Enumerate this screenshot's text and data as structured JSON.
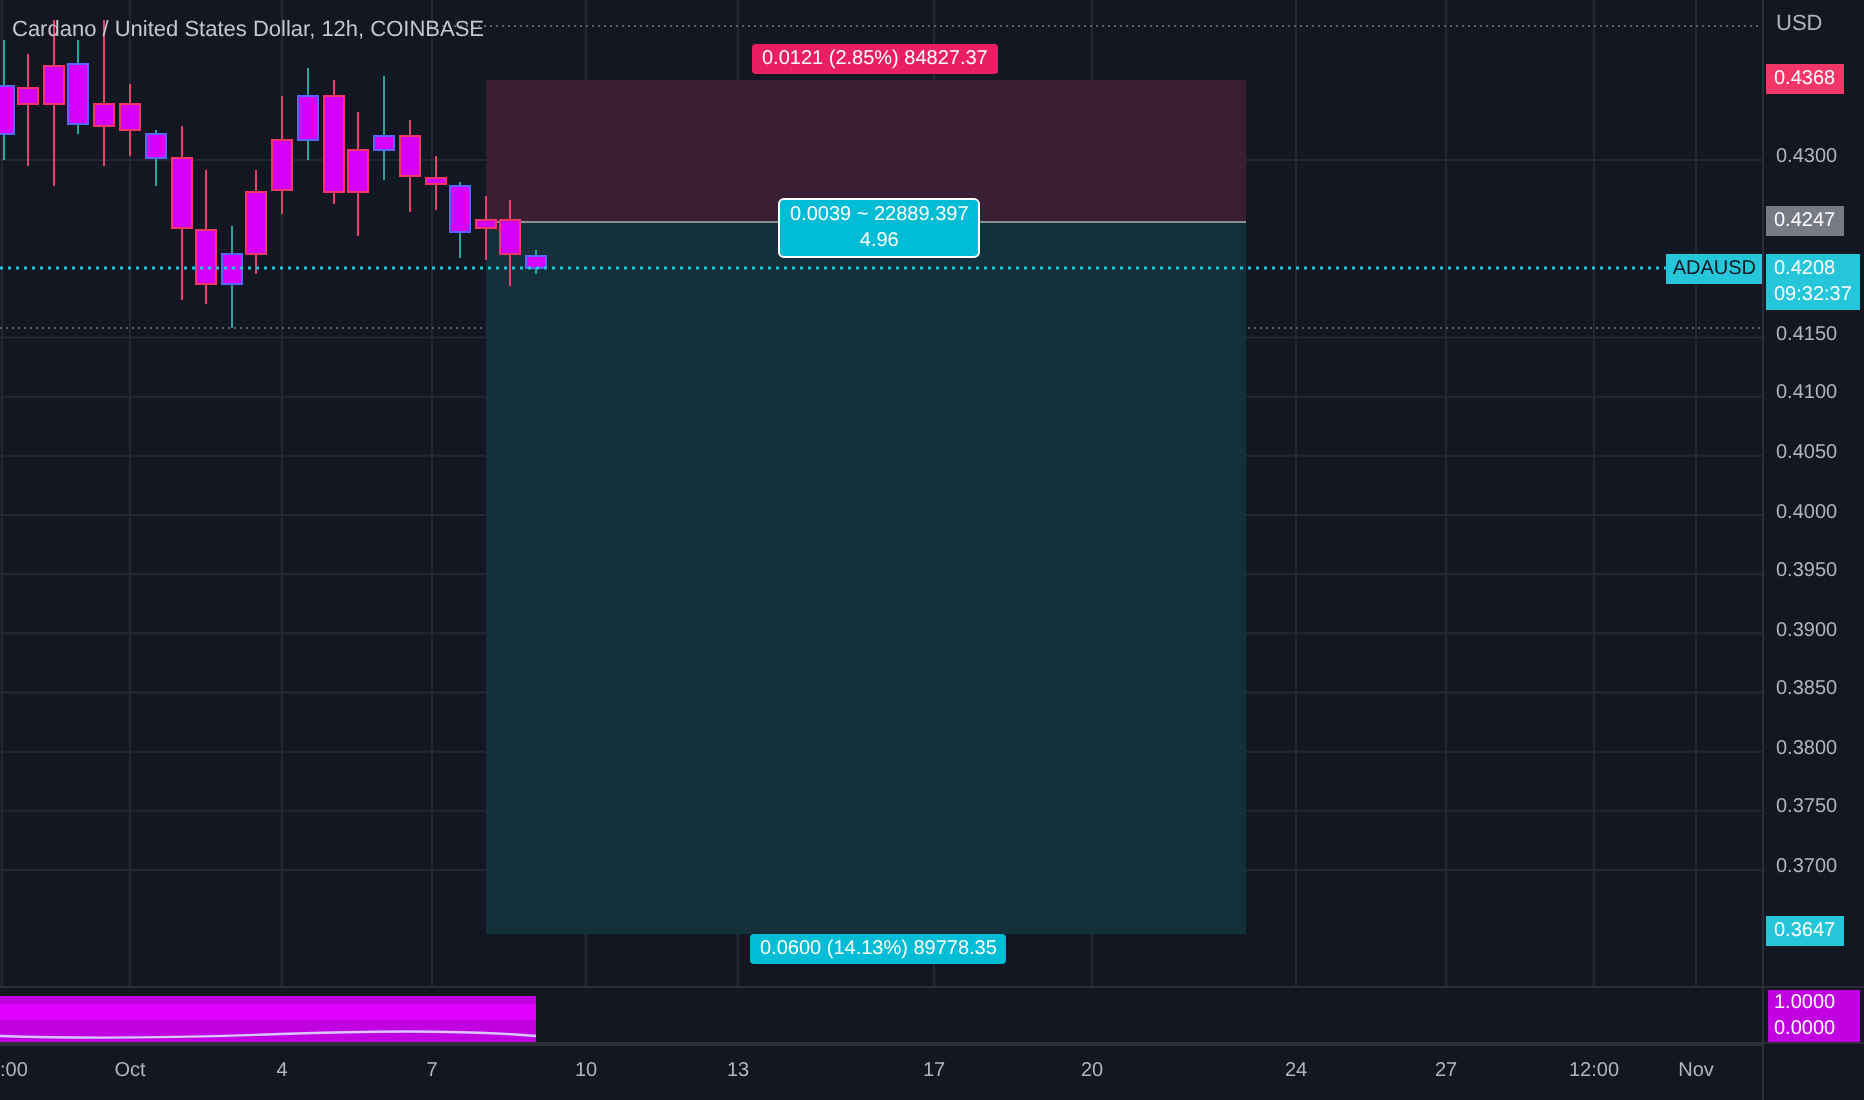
{
  "chart": {
    "title": "Cardano / United States Dollar, 12h, COINBASE",
    "position": {
      "upper_label": "0.0121 (2.85%) 84827.37",
      "middle_label": [
        "0.0039 ~ 22889.397",
        "4.96"
      ],
      "lower_label": "0.0600 (14.13%) 89778.35"
    },
    "symbol_tag": "ADAUSD"
  },
  "price_axis": {
    "unit": "USD",
    "ticks": [
      "0.4300",
      "0.4150",
      "0.4100",
      "0.4050",
      "0.4000",
      "0.3950",
      "0.3900",
      "0.3850",
      "0.3800",
      "0.3750",
      "0.3700"
    ],
    "markers": [
      {
        "kind": "risk",
        "value": "0.4368"
      },
      {
        "kind": "entry",
        "value": "0.4247"
      },
      {
        "kind": "last",
        "value": "0.4208",
        "countdown": "09:32:37"
      },
      {
        "kind": "reward",
        "value": "0.3647"
      }
    ]
  },
  "indicator_axis": {
    "markers": [
      "1.0000",
      "0.0000"
    ]
  },
  "time_axis": {
    "labels": [
      ":00",
      "Oct",
      "4",
      "7",
      "10",
      "13",
      "17",
      "20",
      "24",
      "27",
      "12:00",
      "Nov"
    ]
  }
}
